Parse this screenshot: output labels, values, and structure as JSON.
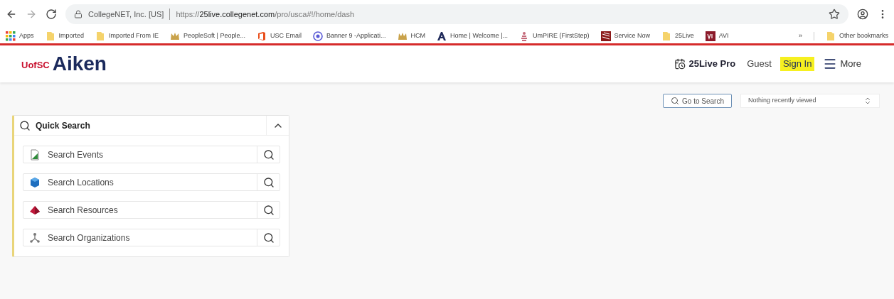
{
  "browser": {
    "site_identity": "CollegeNET, Inc. [US]",
    "url": {
      "scheme": "https://",
      "host": "25live.collegenet.com",
      "path": "/pro/usca#!/home/dash"
    }
  },
  "bookmarks": [
    {
      "kind": "apps",
      "label": "Apps"
    },
    {
      "kind": "folder",
      "label": "Imported"
    },
    {
      "kind": "folder",
      "label": "Imported From IE"
    },
    {
      "kind": "crown",
      "label": "PeopleSoft | People..."
    },
    {
      "kind": "office",
      "label": "USC Email"
    },
    {
      "kind": "circle",
      "label": "Banner 9 -Applicati..."
    },
    {
      "kind": "crown",
      "label": "HCM"
    },
    {
      "kind": "letter",
      "label": "Home | Welcome |..."
    },
    {
      "kind": "figure",
      "label": "UmPIRE (FirstStep)"
    },
    {
      "kind": "stripes",
      "label": "Service Now"
    },
    {
      "kind": "folder",
      "label": "25Live"
    },
    {
      "kind": "square",
      "label": "AVI"
    }
  ],
  "bookmarks_overflow": "»",
  "other_bookmarks": "Other bookmarks",
  "header": {
    "logo_prefix": "UofSC",
    "logo_name": "Aiken",
    "product": "25Live Pro",
    "user": "Guest",
    "sign_in": {
      "label": "Sign In",
      "highlighted": true
    },
    "menu": "More"
  },
  "toolbar": {
    "go_to_search": "Go to Search",
    "recent": "Nothing recently viewed"
  },
  "quick_search": {
    "title": "Quick Search",
    "expanded": true,
    "items": [
      {
        "kind": "events",
        "label": "Search Events"
      },
      {
        "kind": "locations",
        "label": "Search Locations"
      },
      {
        "kind": "resources",
        "label": "Search Resources"
      },
      {
        "kind": "organizations",
        "label": "Search Organizations"
      }
    ]
  }
}
